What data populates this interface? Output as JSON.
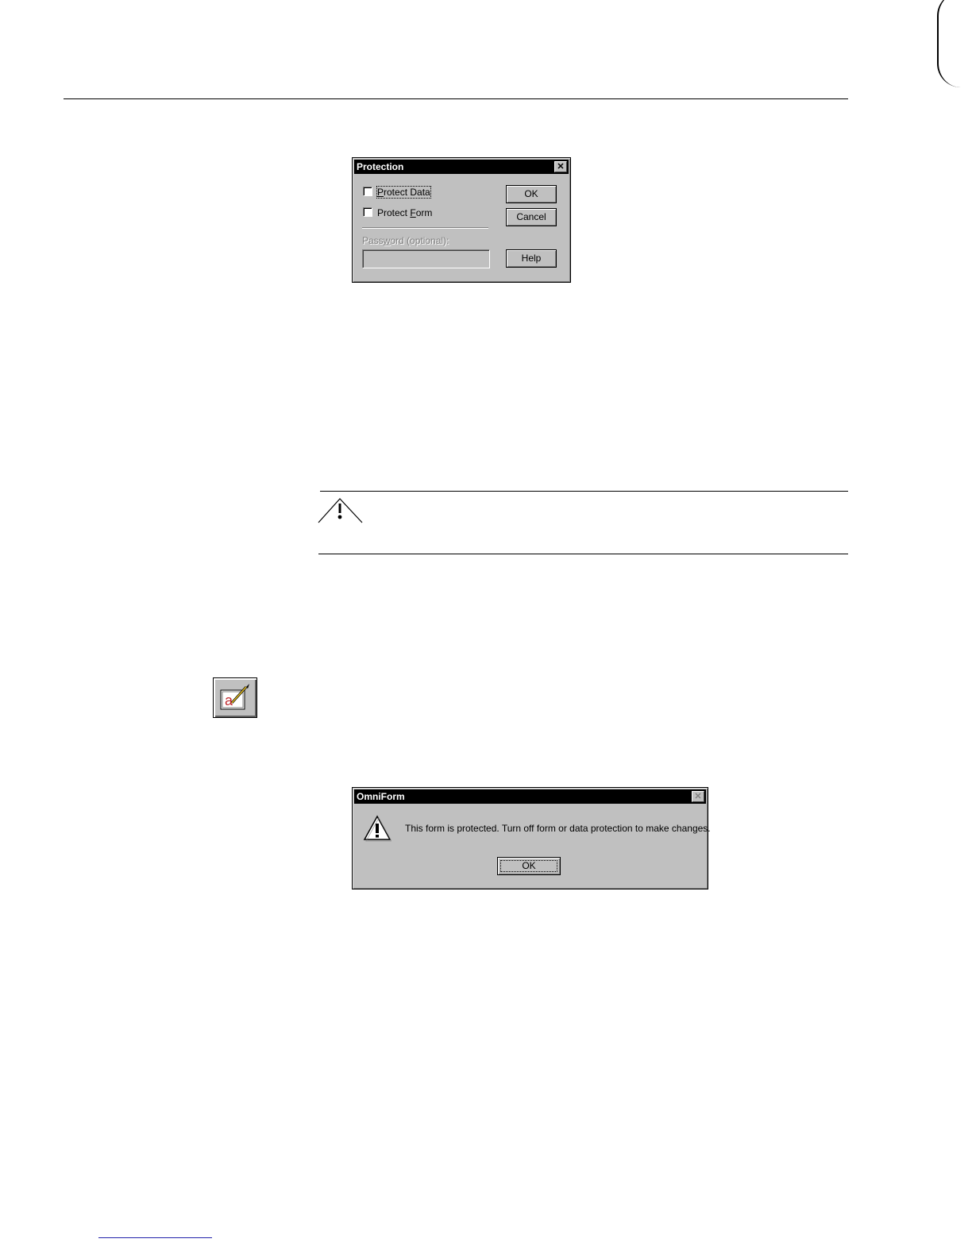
{
  "protection_dialog": {
    "title": "Protection",
    "checkboxes": [
      {
        "label_prefix": "",
        "label_hotkey": "P",
        "label_suffix": "rotect Data",
        "checked": false,
        "focused": true
      },
      {
        "label_prefix": "Protect ",
        "label_hotkey": "F",
        "label_suffix": "orm",
        "checked": false,
        "focused": false
      }
    ],
    "password": {
      "label_prefix": "Pass",
      "label_hotkey": "w",
      "label_suffix": "ord (optional):",
      "value": "",
      "enabled": false
    },
    "buttons": {
      "ok": "OK",
      "cancel": "Cancel",
      "help": "Help"
    }
  },
  "caution": {
    "icon": "caution-warning-icon"
  },
  "toolbar_button": {
    "icon": "edit-field-text-icon",
    "glyph": "a"
  },
  "omniform_dialog": {
    "title": "OmniForm",
    "message": "This form is protected. Turn off form or data protection to make changes.",
    "ok_label": "OK",
    "icon": "exclamation-warning-icon"
  }
}
